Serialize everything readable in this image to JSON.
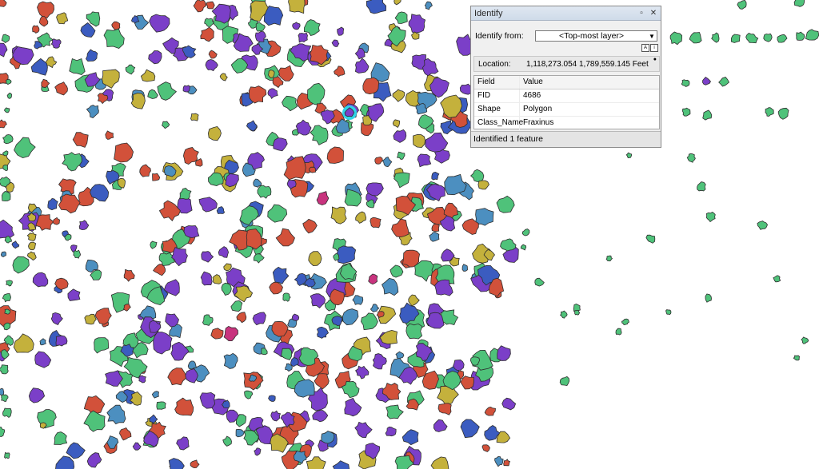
{
  "map": {
    "colors": {
      "red": "#d2513a",
      "purple": "#7b3fc8",
      "green": "#4fc27a",
      "blue": "#3b5cc0",
      "steel": "#4c8fc0",
      "olive": "#c4b13c",
      "magenta": "#c8337e",
      "selected": "#2fd3e8",
      "outline": "#2e2e2e"
    },
    "selected_feature": "fraxinus-polygon"
  },
  "identify": {
    "title": "Identify",
    "identify_from_label": "Identify from:",
    "layer_value": "<Top-most layer>",
    "location_label": "Location:",
    "location_value": "1,118,273.054  1,789,559.145 Feet",
    "columns": {
      "field": "Field",
      "value": "Value"
    },
    "rows": [
      {
        "field": "FID",
        "value": "4686"
      },
      {
        "field": "Shape",
        "value": "Polygon"
      },
      {
        "field": "Class_Name",
        "value": "Fraxinus"
      }
    ],
    "status": "Identified 1 feature",
    "icons": [
      "restore-icon",
      "close-icon",
      "dropdown-arrow-icon",
      "pin-icon"
    ]
  }
}
